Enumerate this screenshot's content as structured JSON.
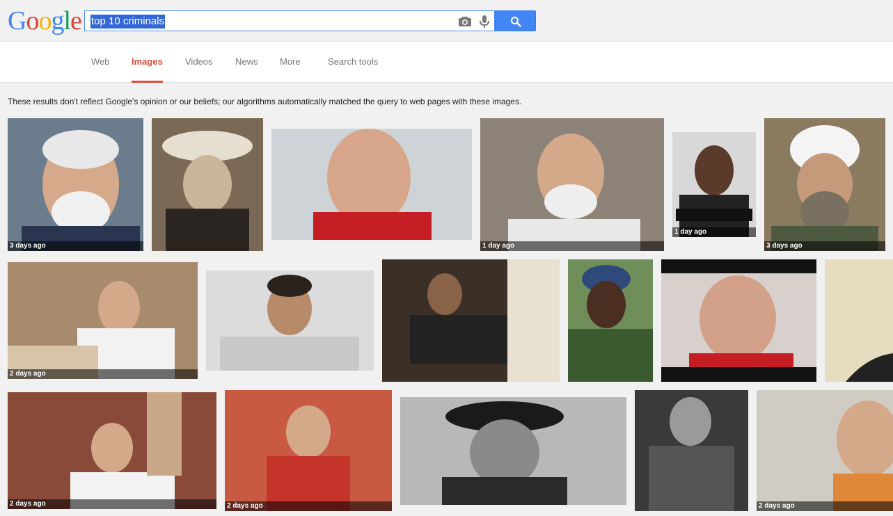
{
  "header": {
    "logo_letters": [
      "G",
      "o",
      "o",
      "g",
      "l",
      "e"
    ],
    "logo_colors": [
      "#4285f4",
      "#db4437",
      "#f4b400",
      "#4285f4",
      "#0f9d58",
      "#db4437"
    ],
    "search_value": "top 10 criminals",
    "camera_icon": "camera-icon",
    "mic_icon": "microphone-icon",
    "search_icon": "magnifier-icon"
  },
  "tabs": [
    {
      "label": "Web"
    },
    {
      "label": "Images"
    },
    {
      "label": "Videos"
    },
    {
      "label": "News"
    },
    {
      "label": "More"
    },
    {
      "label": "Search tools"
    }
  ],
  "active_tab": "Images",
  "accent_color": "#dd4b39",
  "disclaimer": "These results don't reflect Google's opinion or our beliefs; our algorithms automatically matched the query to web pages with these images.",
  "results": [
    {
      "badge": "3 days ago"
    },
    {
      "badge": ""
    },
    {
      "badge": ""
    },
    {
      "badge": "1 day ago"
    },
    {
      "badge": "1 day ago"
    },
    {
      "badge": "3 days ago"
    },
    {
      "badge": "2 days ago"
    },
    {
      "badge": ""
    },
    {
      "badge": ""
    },
    {
      "badge": ""
    },
    {
      "badge": ""
    },
    {
      "badge": ""
    },
    {
      "badge": "2 days ago"
    },
    {
      "badge": "2 days ago"
    },
    {
      "badge": ""
    },
    {
      "badge": ""
    },
    {
      "badge": "2 days ago"
    }
  ]
}
